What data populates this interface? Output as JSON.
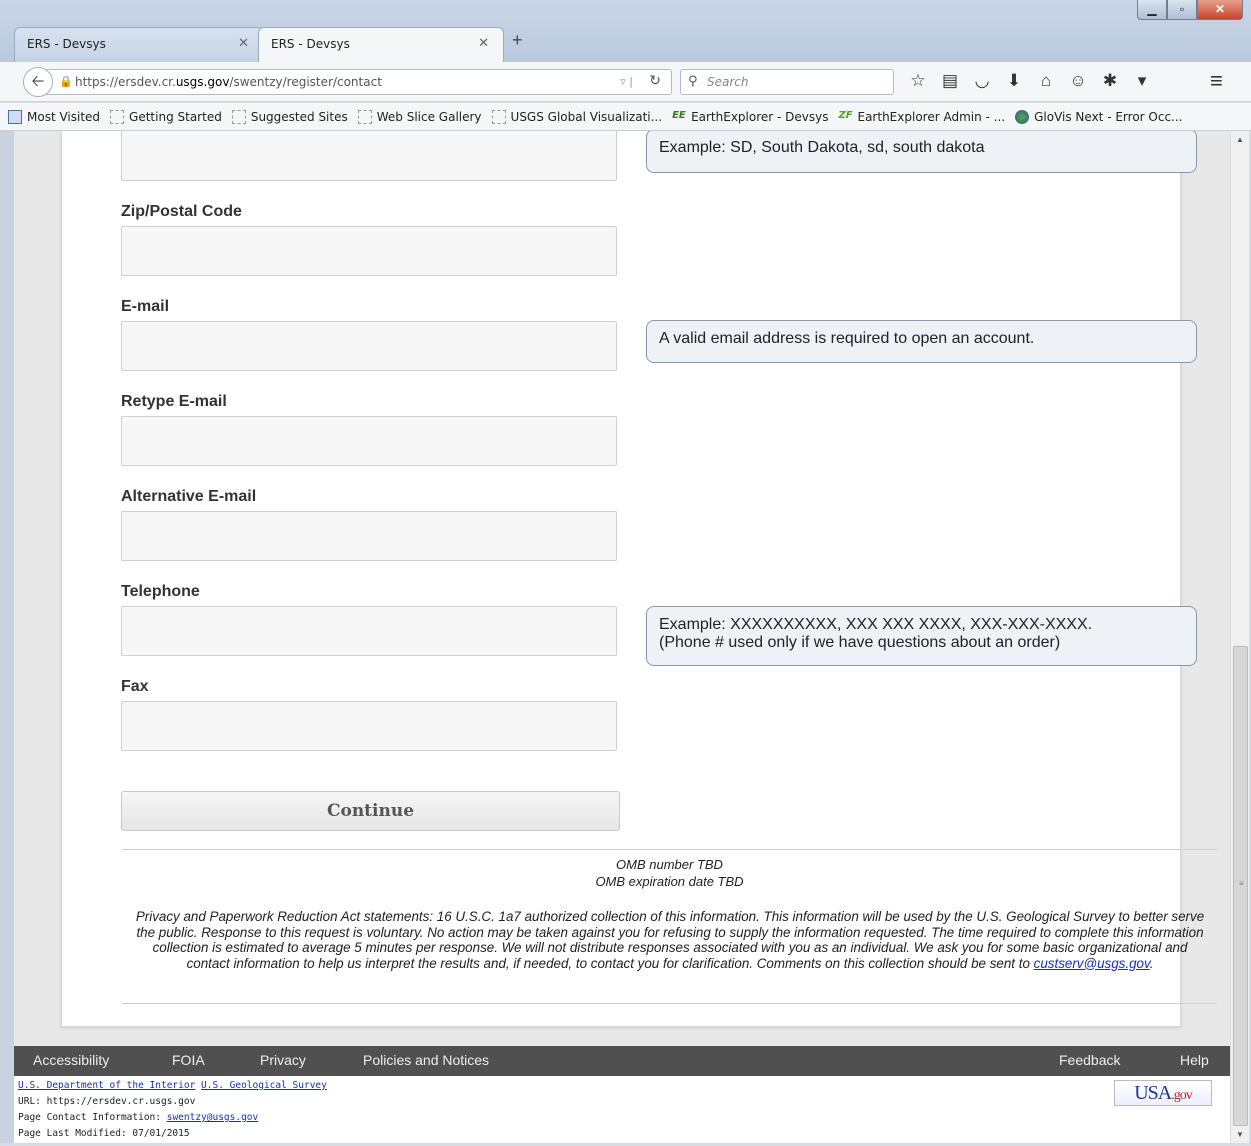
{
  "browser": {
    "tabs": [
      {
        "label": "ERS - Devsys",
        "active": false
      },
      {
        "label": "ERS - Devsys",
        "active": true
      }
    ],
    "new_tab_icon": "+",
    "url_prefix": "https://ersdev.cr.",
    "url_host": "usgs.gov",
    "url_path": "/swentzy/register/contact",
    "search_placeholder": "Search",
    "bookmarks": [
      {
        "label": "Most Visited",
        "icon": "most-visited-icon"
      },
      {
        "label": "Getting Started",
        "icon": "page-icon"
      },
      {
        "label": "Suggested Sites",
        "icon": "page-icon"
      },
      {
        "label": "Web Slice Gallery",
        "icon": "page-icon"
      },
      {
        "label": "USGS Global Visualizati...",
        "icon": "page-icon"
      },
      {
        "label": "EarthExplorer - Devsys",
        "icon": "ee-icon"
      },
      {
        "label": "EarthExplorer Admin - ...",
        "icon": "zf-icon"
      },
      {
        "label": "GloVis Next - Error Occ...",
        "icon": "globe-icon"
      }
    ]
  },
  "form": {
    "fields": [
      {
        "label": "Zip/Postal Code",
        "value": ""
      },
      {
        "label": "E-mail",
        "value": ""
      },
      {
        "label": "Retype E-mail",
        "value": ""
      },
      {
        "label": "Alternative E-mail",
        "value": ""
      },
      {
        "label": "Telephone",
        "value": ""
      },
      {
        "label": "Fax",
        "value": ""
      }
    ],
    "hints": {
      "state": "Example: SD, South Dakota, sd, south dakota",
      "email": "A valid email address is required to open an account.",
      "phone_line1": "Example: XXXXXXXXXX, XXX XXX XXXX, XXX-XXX-XXXX.",
      "phone_line2": "(Phone # used only if we have questions about an order)"
    },
    "continue_label": "Continue"
  },
  "notice": {
    "omb_number": "OMB number TBD",
    "omb_expiration": "OMB expiration date TBD",
    "privacy_text": "Privacy and Paperwork Reduction Act statements: 16 U.S.C. 1a7 authorized collection of this information. This information will be used by the U.S. Geological Survey to better serve the public. Response to this request is voluntary. No action may be taken against you for refusing to supply the information requested. The time required to complete this information collection is estimated to average 5 minutes per response. We will not distribute responses associated with you as an individual. We ask you for some basic organizational and contact information to help us interpret the results and, if needed, to contact you for clarification. Comments on this collection should be sent to",
    "privacy_email": "custserv@usgs.gov",
    "privacy_period": "."
  },
  "footer": {
    "nav": [
      "Accessibility",
      "FOIA",
      "Privacy",
      "Policies and Notices"
    ],
    "feedback": "Feedback",
    "help": "Help",
    "doi_link": "U.S. Department of the Interior",
    "usgs_link": "U.S. Geological Survey",
    "url_line": "URL: https://ersdev.cr.usgs.gov",
    "contact_prefix": "Page Contact Information: ",
    "contact_email": "swentzy@usgs.gov",
    "modified": "Page Last Modified: 07/01/2015",
    "usagov_usa": "USA",
    "usagov_gov": ".gov"
  }
}
